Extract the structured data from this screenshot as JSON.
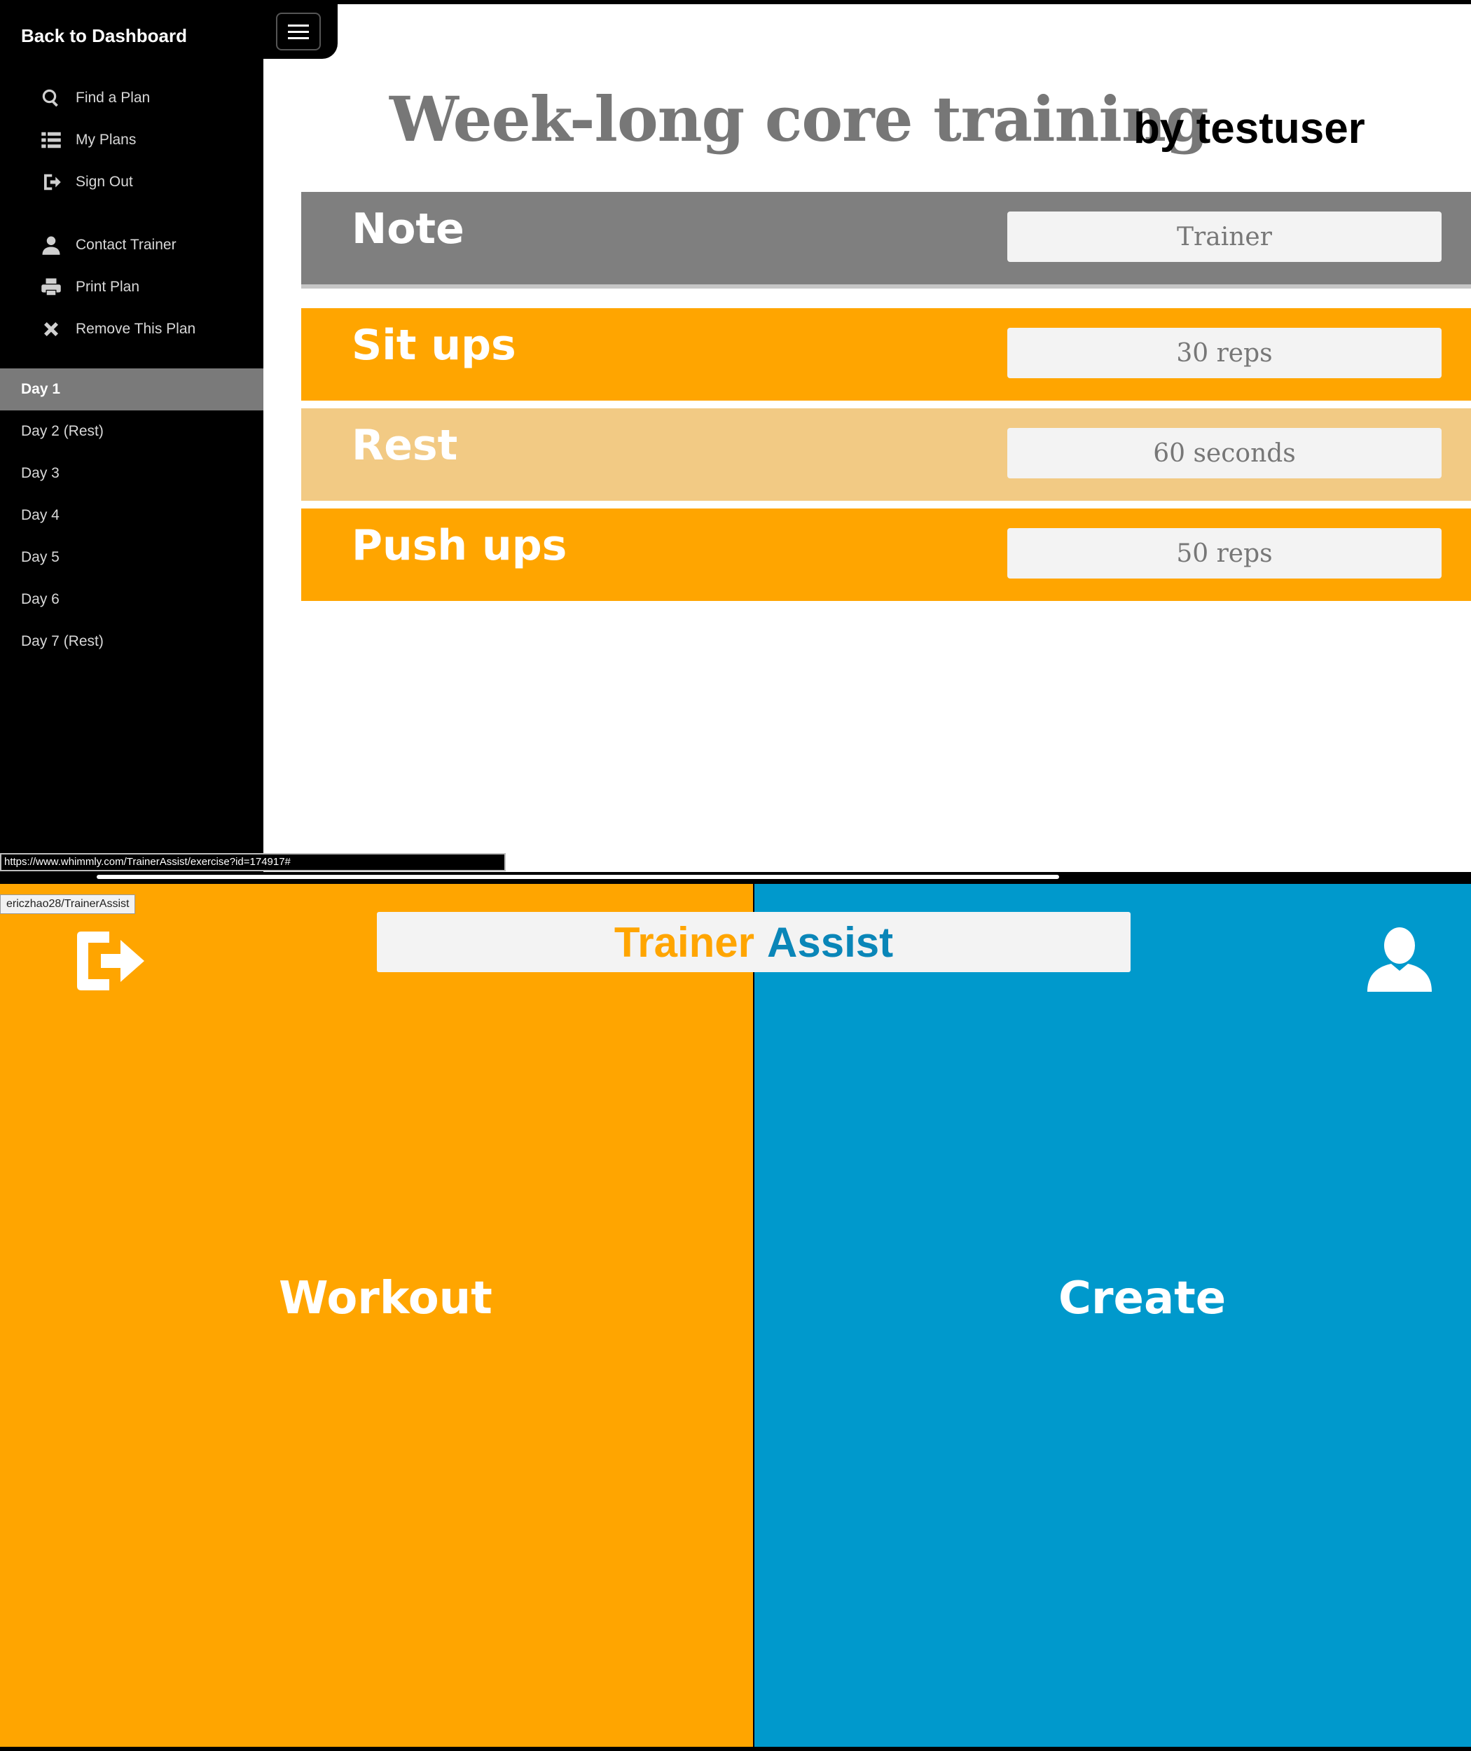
{
  "sidebar": {
    "back_label": "Back to Dashboard",
    "menu": [
      {
        "label": "Find a Plan",
        "icon": "search-icon"
      },
      {
        "label": "My Plans",
        "icon": "list-icon"
      },
      {
        "label": "Sign Out",
        "icon": "sign-out-icon"
      },
      {
        "label": "Contact Trainer",
        "icon": "user-icon"
      },
      {
        "label": "Print Plan",
        "icon": "print-icon"
      },
      {
        "label": "Remove This Plan",
        "icon": "close-icon"
      }
    ],
    "days": [
      {
        "label": "Day 1",
        "active": true
      },
      {
        "label": "Day 2 (Rest)",
        "active": false
      },
      {
        "label": "Day 3",
        "active": false
      },
      {
        "label": "Day 4",
        "active": false
      },
      {
        "label": "Day 5",
        "active": false
      },
      {
        "label": "Day 6",
        "active": false
      },
      {
        "label": "Day 7 (Rest)",
        "active": false
      }
    ]
  },
  "plan": {
    "title": "Week-long core training",
    "author": "by testuser",
    "rows": [
      {
        "label": "Note",
        "value": "Trainer"
      },
      {
        "label": "Sit ups",
        "value": "30 reps"
      },
      {
        "label": "Rest",
        "value": "60 seconds"
      },
      {
        "label": "Push ups",
        "value": "50 reps"
      }
    ]
  },
  "status_url": "https://www.whimmly.com/TrainerAssist/exercise?id=174917#",
  "home": {
    "repo_tag": "ericzhao28/TrainerAssist",
    "title_part1": "Trainer",
    "title_part2": "Assist",
    "workout_label": "Workout",
    "create_label": "Create"
  },
  "colors": {
    "orange": "#ffa500",
    "light_orange": "#f2ca84",
    "blue": "#0099cc",
    "gray": "#7f7f7f"
  }
}
